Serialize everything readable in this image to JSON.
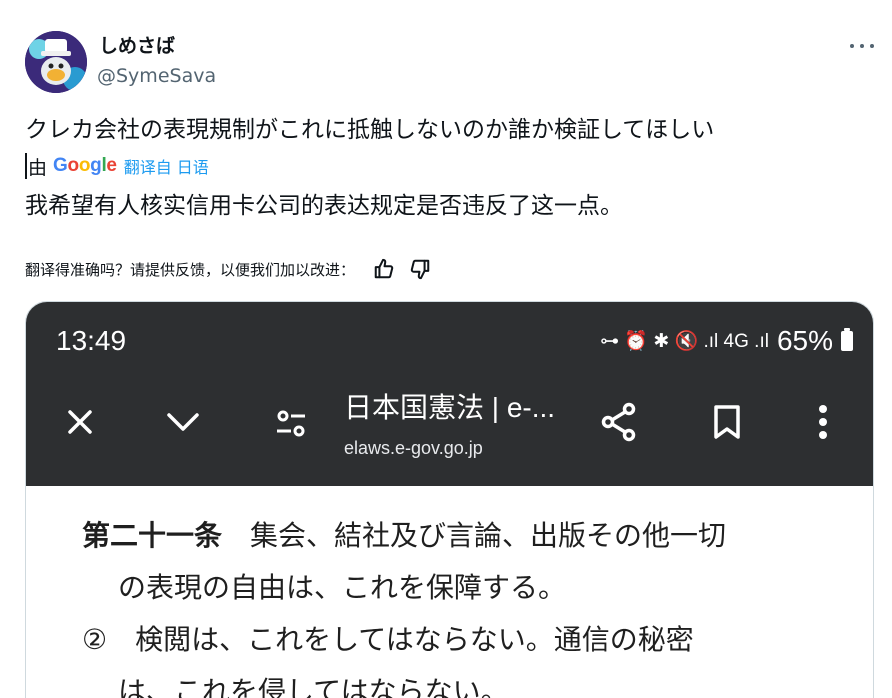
{
  "tweet": {
    "display_name": "しめさば",
    "handle": "@SymeSava",
    "text": "クレカ会社の表現規制がこれに抵触しないのか誰か検証してほしい"
  },
  "translation": {
    "by": "由",
    "google_letters": [
      "G",
      "o",
      "o",
      "g",
      "l",
      "e"
    ],
    "translated_from": "翻译自 日语",
    "text": "我希望有人核实信用卡公司的表达规定是否违反了这一点。",
    "feedback_prompt": "翻译得准确吗？请提供反馈，以便我们加以改进："
  },
  "icons": {
    "more": "more-icon",
    "thumbs_up": "thumbs-up-icon",
    "thumbs_down": "thumbs-down-icon",
    "close": "close-icon",
    "chevron": "chevron-down-icon",
    "tune": "tune-icon",
    "share": "share-icon",
    "bookmark": "bookmark-icon",
    "menu": "more-vert-icon"
  },
  "phone": {
    "time": "13:49",
    "status_text": "⊶ ⏰ ✱ 🔇 .ıl 4G .ıl",
    "battery": "65%",
    "page_title": "日本国憲法 | e-...",
    "page_url": "elaws.e-gov.go.jp",
    "law_lines": [
      {
        "bold": "第二十一条",
        "text": "　集会、結社及び言論、出版その他一切"
      },
      {
        "bold": "",
        "text": "の表現の自由は、これを保障する。"
      },
      {
        "bold": "",
        "text": "②　検閲は、これをしてはならない。通信の秘密"
      },
      {
        "bold": "",
        "text": "は、これを侵してはならない。"
      }
    ]
  },
  "colors": {
    "link_blue": "#1d9bf0",
    "phone_bar": "#2d2f31",
    "secondary_text": "#536471"
  }
}
